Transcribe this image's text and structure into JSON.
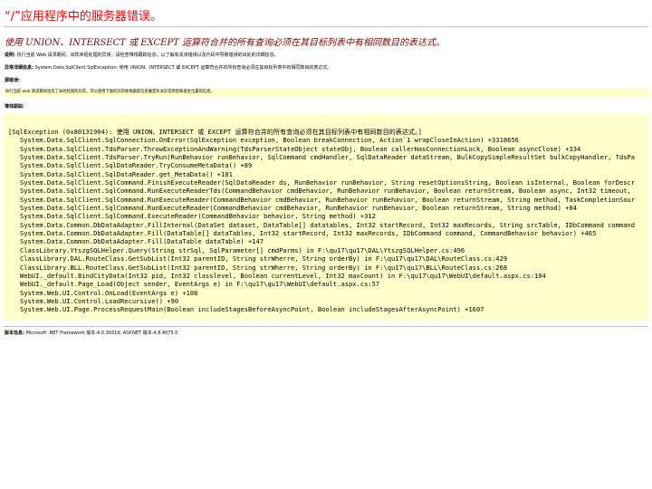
{
  "page": {
    "title": "“/”应用程序中的服务器错误。",
    "error_message": "使用 UNION、INTERSECT 或 EXCEPT 运算符合并的所有查询必须在其目标列表中有相同数目的表达式。"
  },
  "description": {
    "label": "说明:",
    "text": "执行当前 Web 请求期间，出现未经处理的异常。请检查堆栈跟踪信息，以了解有关该错误以及代码中导致错误的出处的详细信息。"
  },
  "exception_details": {
    "label": "异常详细信息:",
    "text": "System.Data.SqlClient.SqlException: 使用 UNION、INTERSECT 或 EXCEPT 运算符合并的所有查询必须在其目标列表中有相同数目的表达式。"
  },
  "source_error": {
    "label": "源错误:",
    "text": "执行当前 web 请求期间生成了未经处理的异常。可以使用下面的异常堆栈跟踪信息确定有关异常原因和发生位置的信息。"
  },
  "stack_trace": {
    "label": "堆栈跟踪:",
    "header": "[SqlException (0x80131904): 使用 UNION、INTERSECT 或 EXCEPT 运算符合并的所有查询必须在其目标列表中有相同数目的表达式。]",
    "lines": [
      "System.Data.SqlClient.SqlConnection.OnError(SqlException exception, Boolean breakConnection, Action`1 wrapCloseInAction) +3318656",
      "System.Data.SqlClient.TdsParser.ThrowExceptionAndWarning(TdsParserStateObject stateObj, Boolean callerHasConnectionLock, Boolean asyncClose) +334",
      "System.Data.SqlClient.TdsParser.TryRun(RunBehavior runBehavior, SqlCommand cmdHandler, SqlDataReader dataStream, BulkCopySimpleResultSet bulkCopyHandler, TdsPa",
      "System.Data.SqlClient.SqlDataReader.TryConsumeMetaData() +89",
      "System.Data.SqlClient.SqlDataReader.get_MetaData() +101",
      "System.Data.SqlClient.SqlCommand.FinishExecuteReader(SqlDataReader ds, RunBehavior runBehavior, String resetOptionsString, Boolean isInternal, Boolean forDescr",
      "System.Data.SqlClient.SqlCommand.RunExecuteReaderTds(CommandBehavior cmdBehavior, RunBehavior runBehavior, Boolean returnStream, Boolean async, Int32 timeout, ",
      "System.Data.SqlClient.SqlCommand.RunExecuteReader(CommandBehavior cmdBehavior, RunBehavior runBehavior, Boolean returnStream, String method, TaskCompletionSour",
      "System.Data.SqlClient.SqlCommand.RunExecuteReader(CommandBehavior cmdBehavior, RunBehavior runBehavior, Boolean returnStream, String method) +84",
      "System.Data.SqlClient.SqlCommand.ExecuteReader(CommandBehavior behavior, String method) +312",
      "System.Data.Common.DbDataAdapter.FillInternal(DataSet dataset, DataTable[] datatables, Int32 startRecord, Int32 maxRecords, String srcTable, IDbCommand command",
      "System.Data.Common.DbDataAdapter.Fill(DataTable[] dataTables, Int32 startRecord, Int32 maxRecords, IDbCommand command, CommandBehavior behavior) +465",
      "System.Data.Common.DbDataAdapter.Fill(DataTable dataTable) +147",
      "ClassLibrary.YtszgSQLHelper.Query(String strSql, SqlParameter[] cmdParms) in F:\\qu17\\qu17\\DAL\\YtszgSQLHelper.cs:496",
      "ClassLibrary.DAL.RouteClass.GetSubList(Int32 parentID, String strWherre, String orderBy) in F:\\qu17\\qu17\\DAL\\RouteClass.cs:429",
      "ClassLibrary.BLL.RouteClass.GetSubList(Int32 parentID, String strWherre, String orderBy) in F:\\qu17\\qu17\\BLL\\RouteClass.cs:268",
      "WebUI._default.BindCityData(Int32 pid, Int32 classlevel, Boolean currentLevel, Int32 maxCount) in F:\\qu17\\qu17\\WebUI\\default.aspx.cs:104",
      "WebUI._default.Page_Load(Object sender, EventArgs e) in F:\\qu17\\qu17\\WebUI\\default.aspx.cs:57",
      "System.Web.UI.Control.OnLoad(EventArgs e) +108",
      "System.Web.UI.Control.LoadRecursive() +90",
      "System.Web.UI.Page.ProcessRequestMain(Boolean includeStagesBeforeAsyncPoint, Boolean includeStagesAfterAsyncPoint) +1607"
    ]
  },
  "version_info": {
    "label": "版本信息:",
    "text": "Microsoft .NET Framework 版本:4.0.30319; ASP.NET 版本:4.8.4075.0"
  },
  "colors": {
    "title": "#ff0000",
    "subtitle": "#800000",
    "code_background": "#ffffcc",
    "rule": "#c0c0c0"
  }
}
